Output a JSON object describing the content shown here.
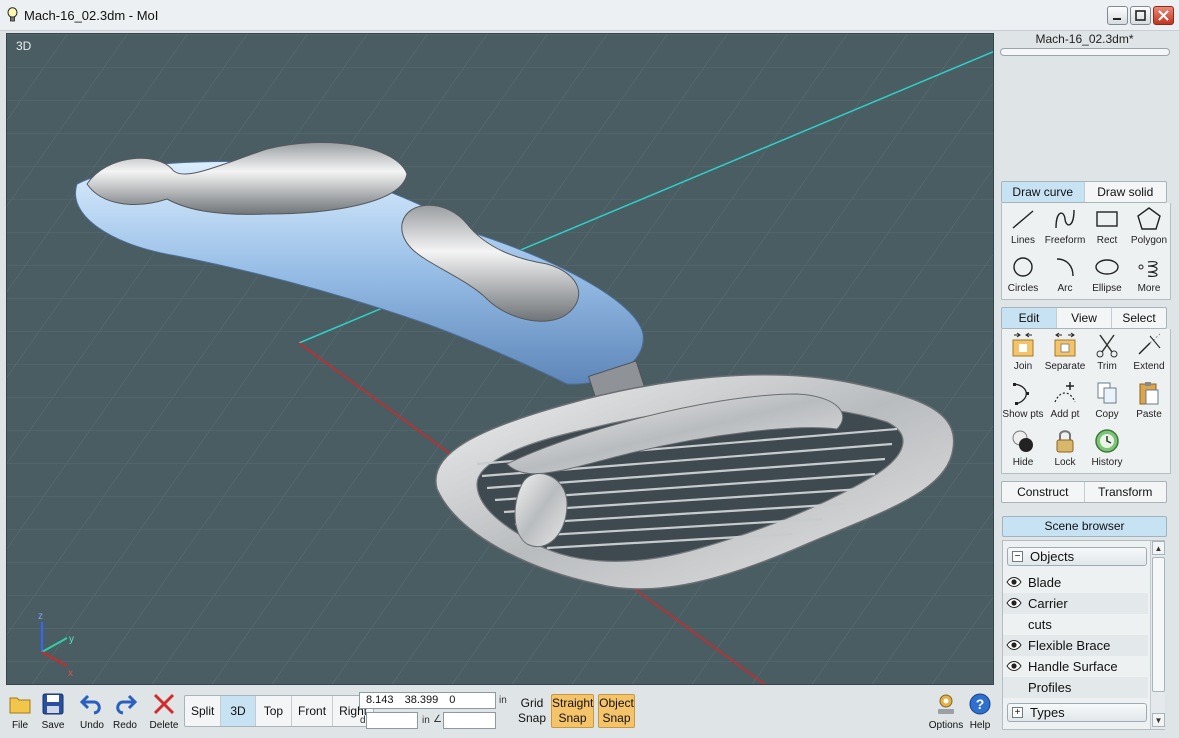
{
  "window": {
    "title": "Mach-16_02.3dm - MoI",
    "buttons": [
      "minimize",
      "maximize",
      "close"
    ]
  },
  "viewport": {
    "label": "3D",
    "axes": {
      "z": "z",
      "y": "y",
      "x": "x"
    }
  },
  "panel": {
    "filename": "Mach-16_02.3dm*",
    "draw_tabs": [
      "Draw curve",
      "Draw solid"
    ],
    "draw_tools": [
      {
        "label": "Lines",
        "icon": "line-icon"
      },
      {
        "label": "Freeform",
        "icon": "freeform-curve-icon"
      },
      {
        "label": "Rect",
        "icon": "rectangle-icon"
      },
      {
        "label": "Polygon",
        "icon": "polygon-icon"
      },
      {
        "label": "Circles",
        "icon": "circle-icon"
      },
      {
        "label": "Arc",
        "icon": "arc-icon"
      },
      {
        "label": "Ellipse",
        "icon": "ellipse-icon"
      },
      {
        "label": "More",
        "icon": "more-curves-icon"
      }
    ],
    "edit_tabs": [
      "Edit",
      "View",
      "Select"
    ],
    "edit_tools": [
      {
        "label": "Join",
        "icon": "join-icon"
      },
      {
        "label": "Separate",
        "icon": "separate-icon"
      },
      {
        "label": "Trim",
        "icon": "scissors-icon"
      },
      {
        "label": "Extend",
        "icon": "extend-icon"
      },
      {
        "label": "Show pts",
        "icon": "show-points-icon"
      },
      {
        "label": "Add pt",
        "icon": "add-point-icon"
      },
      {
        "label": "Copy",
        "icon": "copy-icon"
      },
      {
        "label": "Paste",
        "icon": "paste-icon"
      },
      {
        "label": "Hide",
        "icon": "hide-icon"
      },
      {
        "label": "Lock",
        "icon": "lock-icon"
      },
      {
        "label": "History",
        "icon": "history-icon"
      }
    ],
    "construct_tabs": [
      "Construct",
      "Transform"
    ],
    "scene_browser": "Scene browser",
    "objects_group": "Objects",
    "objects": [
      {
        "name": "Blade",
        "visible": true
      },
      {
        "name": "Carrier",
        "visible": true
      },
      {
        "name": "cuts",
        "visible": false
      },
      {
        "name": "Flexible Brace",
        "visible": true
      },
      {
        "name": "Handle Surface",
        "visible": true
      },
      {
        "name": "Profiles",
        "visible": false
      }
    ],
    "types_group": "Types"
  },
  "toolbar": {
    "file": "File",
    "save": "Save",
    "undo": "Undo",
    "redo": "Redo",
    "delete": "Delete",
    "views": [
      "Split",
      "3D",
      "Top",
      "Front",
      "Right"
    ],
    "active_view": "3D",
    "coords": "8.143  38.399  0",
    "coord_unit": "in",
    "distance_label": "d",
    "distance_unit": "in",
    "angle_label": "∠",
    "grid_snap": [
      "Grid",
      "Snap"
    ],
    "straight_snap": [
      "Straight",
      "Snap"
    ],
    "object_snap": [
      "Object",
      "Snap"
    ],
    "options": "Options",
    "help": "Help"
  },
  "colors": {
    "viewport_bg": "#4a5d63",
    "accent_tab": "#c7e2f3",
    "snap_on": "#f5c46a",
    "axis_x": "#d02828",
    "axis_y": "#2fd0c8",
    "handle": "#9cc4ec"
  }
}
